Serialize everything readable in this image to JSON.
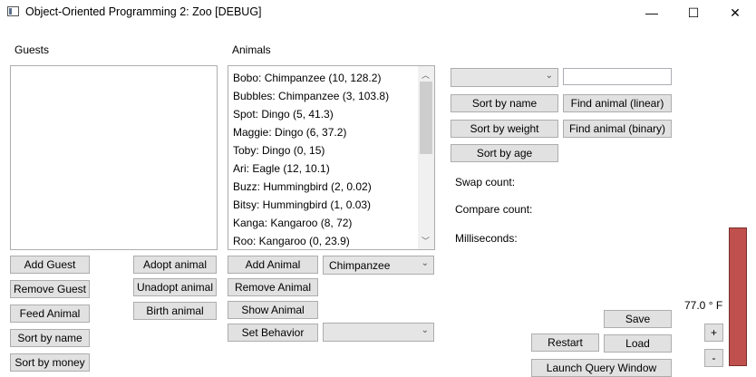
{
  "window": {
    "title": "Object-Oriented Programming 2: Zoo [DEBUG]",
    "controls": {
      "minimize": "—",
      "maximize": "☐",
      "close": "✕"
    }
  },
  "guests": {
    "label": "Guests",
    "items": [],
    "buttons": {
      "add_guest": "Add Guest",
      "remove_guest": "Remove Guest",
      "feed_animal": "Feed Animal",
      "sort_by_name": "Sort by name",
      "sort_by_money": "Sort by money",
      "adopt_animal": "Adopt animal",
      "unadopt_animal": "Unadopt animal",
      "birth_animal": "Birth animal"
    }
  },
  "animals": {
    "label": "Animals",
    "items": [
      "Bobo: Chimpanzee (10, 128.2)",
      "Bubbles: Chimpanzee (3, 103.8)",
      "Spot: Dingo (5, 41.3)",
      "Maggie: Dingo (6, 37.2)",
      "Toby: Dingo (0, 15)",
      "Ari: Eagle (12, 10.1)",
      "Buzz: Hummingbird (2, 0.02)",
      "Bitsy: Hummingbird (1, 0.03)",
      "Kanga: Kangaroo (8, 72)",
      "Roo: Kangaroo (0, 23.9)"
    ],
    "buttons": {
      "add_animal": "Add Animal",
      "remove_animal": "Remove Animal",
      "show_animal": "Show Animal",
      "set_behavior": "Set Behavior"
    },
    "animal_type_selected": "Chimpanzee",
    "behavior_selected": ""
  },
  "search": {
    "combo_selected": "",
    "text_value": "",
    "buttons": {
      "sort_by_name": "Sort by name",
      "sort_by_weight": "Sort by weight",
      "sort_by_age": "Sort by age",
      "find_linear": "Find animal (linear)",
      "find_binary": "Find animal (binary)"
    }
  },
  "stats": {
    "swap_count_label": "Swap count:",
    "compare_count_label": "Compare count:",
    "milliseconds_label": "Milliseconds:"
  },
  "footer": {
    "save": "Save",
    "load": "Load",
    "restart": "Restart",
    "launch_query": "Launch Query Window"
  },
  "temperature": {
    "text": "77.0 ° F",
    "plus": "+",
    "minus": "-",
    "level": 1.0,
    "color": "#c0504d"
  }
}
